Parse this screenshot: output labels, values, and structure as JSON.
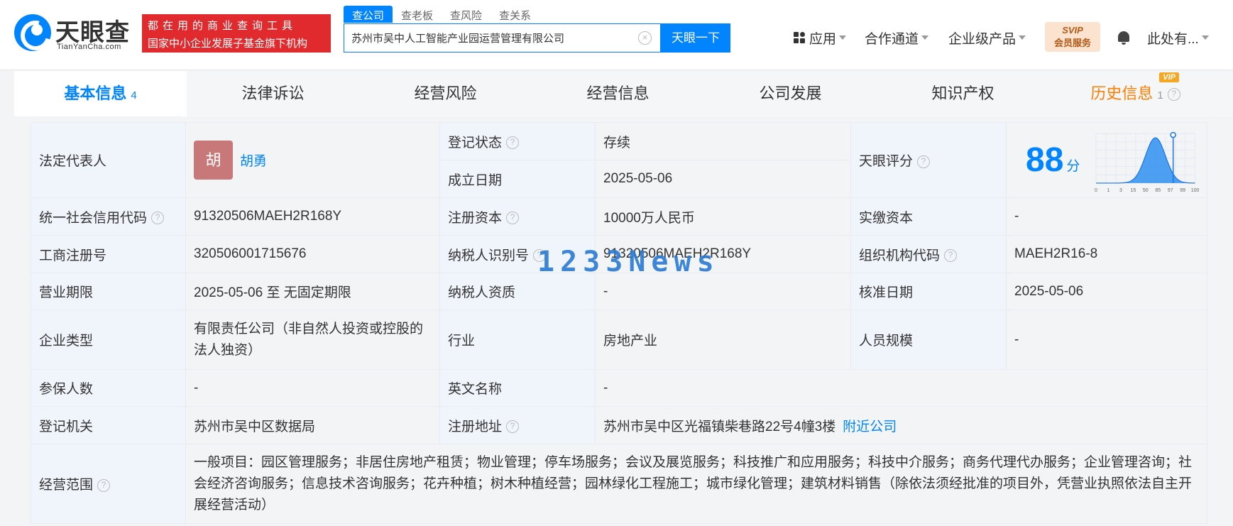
{
  "header": {
    "logo_cn": "天眼查",
    "logo_en": "TianYanCha.com",
    "slogan_line1": "都在用的商业查询工具",
    "slogan_line2": "国家中小企业发展子基金旗下机构",
    "search_tabs": [
      "查公司",
      "查老板",
      "查风险",
      "查关系"
    ],
    "search_value": "苏州市吴中人工智能产业园运营管理有限公司",
    "search_button": "天眼一下",
    "nav": {
      "apps": "应用",
      "partner": "合作通道",
      "enterprise": "企业级产品",
      "svip_top": "SVIP",
      "svip_bottom": "会员服务",
      "user": "此处有..."
    }
  },
  "tabs": [
    {
      "label": "基本信息",
      "count": "4"
    },
    {
      "label": "法律诉讼",
      "count": ""
    },
    {
      "label": "经营风险",
      "count": ""
    },
    {
      "label": "经营信息",
      "count": ""
    },
    {
      "label": "公司发展",
      "count": ""
    },
    {
      "label": "知识产权",
      "count": ""
    },
    {
      "label": "历史信息",
      "count": "1",
      "badge": "VIP"
    }
  ],
  "info": {
    "legal_rep_label": "法定代表人",
    "legal_rep_avatar": "胡",
    "legal_rep_name": "胡勇",
    "reg_status_label": "登记状态",
    "reg_status_value": "存续",
    "found_date_label": "成立日期",
    "found_date_value": "2025-05-06",
    "score_label": "天眼评分",
    "score_value": "88",
    "score_unit": "分",
    "credit_code_label": "统一社会信用代码",
    "credit_code_value": "91320506MAEH2R168Y",
    "reg_capital_label": "注册资本",
    "reg_capital_value": "10000万人民币",
    "paid_capital_label": "实缴资本",
    "paid_capital_value": "-",
    "biz_reg_no_label": "工商注册号",
    "biz_reg_no_value": "320506001715676",
    "taxpayer_id_label": "纳税人识别号",
    "taxpayer_id_value": "91320506MAEH2R168Y",
    "org_code_label": "组织机构代码",
    "org_code_value": "MAEH2R16-8",
    "term_label": "营业期限",
    "term_value": "2025-05-06 至 无固定期限",
    "taxpayer_qual_label": "纳税人资质",
    "taxpayer_qual_value": "-",
    "approve_date_label": "核准日期",
    "approve_date_value": "2025-05-06",
    "company_type_label": "企业类型",
    "company_type_value": "有限责任公司（非自然人投资或控股的法人独资）",
    "industry_label": "行业",
    "industry_value": "房地产业",
    "staff_size_label": "人员规模",
    "staff_size_value": "-",
    "insured_label": "参保人数",
    "insured_value": "-",
    "en_name_label": "英文名称",
    "en_name_value": "-",
    "authority_label": "登记机关",
    "authority_value": "苏州市吴中区数据局",
    "address_label": "注册地址",
    "address_value": "苏州市吴中区光福镇柴巷路22号4幢3楼",
    "nearby_link": "附近公司",
    "scope_label": "经营范围",
    "scope_value": "一般项目：园区管理服务；非居住房地产租赁；物业管理；停车场服务；会议及展览服务；科技推广和应用服务；科技中介服务；商务代理代办服务；企业管理咨询；社会经济咨询服务；信息技术咨询服务；花卉种植；树木种植经营；园林绿化工程施工；城市绿化管理；建筑材料销售（除依法须经批准的项目外，凭营业执照依法自主开展经营活动）"
  },
  "score_chart": {
    "x_ticks": [
      "0",
      "1",
      "3",
      "15",
      "50",
      "85",
      "97",
      "99",
      "100"
    ],
    "marker_value": 88
  },
  "watermark": "1233News"
}
